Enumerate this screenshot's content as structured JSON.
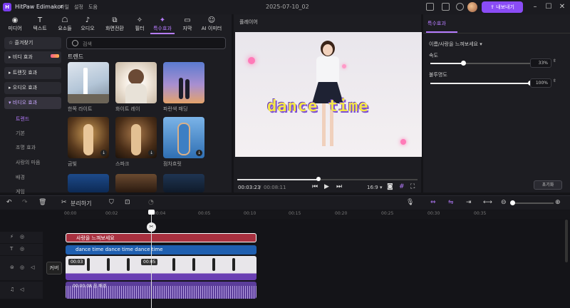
{
  "app": {
    "name": "HitPaw Edimakor",
    "project_title": "2025-07-10_02",
    "menu": [
      "파일",
      "설정",
      "도움"
    ],
    "export_label": "내보내기",
    "accent": "#8a4cf5"
  },
  "tabs": [
    {
      "label": "미디어",
      "icon": "media-icon"
    },
    {
      "label": "텍스트",
      "icon": "text-icon"
    },
    {
      "label": "요소들",
      "icon": "elements-icon"
    },
    {
      "label": "오디오",
      "icon": "audio-icon"
    },
    {
      "label": "화면전환",
      "icon": "transition-icon"
    },
    {
      "label": "필터",
      "icon": "filter-icon"
    },
    {
      "label": "특수효과",
      "icon": "effects-icon",
      "active": true
    },
    {
      "label": "자막",
      "icon": "subtitle-icon"
    },
    {
      "label": "AI 이미터",
      "icon": "ai-icon"
    }
  ],
  "sidebar": {
    "favorites": "즐겨찾기",
    "items": [
      "비디 효과",
      "트랜짓 효과",
      "오디오 효과",
      "비디오 효과"
    ],
    "subitems": [
      "트렌드",
      "기본",
      "조명 효과",
      "사랑의 마음",
      "배경",
      "게임"
    ]
  },
  "search": {
    "placeholder": "검색"
  },
  "section_title": "트렌드",
  "effects": [
    {
      "label": "한쪽 라이트"
    },
    {
      "label": "화이트 레이"
    },
    {
      "label": "파란색 패딩"
    },
    {
      "label": "금빛"
    },
    {
      "label": "스파크"
    },
    {
      "label": "점차흐릿"
    },
    {
      "label": ""
    },
    {
      "label": ""
    },
    {
      "label": ""
    }
  ],
  "player": {
    "title": "플레이어",
    "overlay_text": "dance time",
    "current_time": "00:03:23",
    "total_time": "00:08:11",
    "aspect": "16:9",
    "progress": 0.45
  },
  "right_panel": {
    "tab": "특수효과",
    "effect_name": "이름/사랑을 느껴보세요",
    "params": [
      {
        "label": "속도",
        "value": "33%",
        "fraction": 0.33
      },
      {
        "label": "불투명도",
        "value": "100%",
        "fraction": 1.0
      }
    ],
    "reset_label": "초기화"
  },
  "toolbar": {
    "split_label": "분리하기"
  },
  "ruler": [
    "00:00",
    "00:02",
    "00:04",
    "00:05",
    "00:10",
    "00:15",
    "00:20",
    "00:25",
    "00:30",
    "00:35"
  ],
  "timeline": {
    "effect_clip": "사랑을 느껴보세요",
    "text_clip": "dance time dance time dance time",
    "video_durations": [
      "00:03",
      "00:05"
    ],
    "cover_label": "커버",
    "audio_clip": "00:00:08 음 배경"
  }
}
